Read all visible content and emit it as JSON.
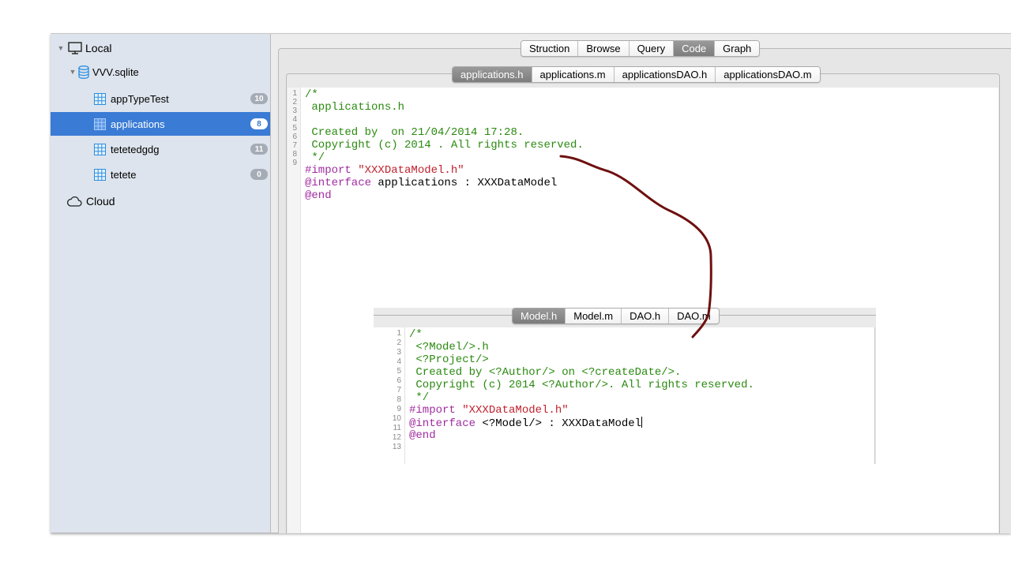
{
  "sidebar": {
    "local": {
      "label": "Local"
    },
    "database": {
      "label": "VVV.sqlite"
    },
    "tables": [
      {
        "label": "appTypeTest",
        "count": "10",
        "selected": false
      },
      {
        "label": "applications",
        "count": "8",
        "selected": true
      },
      {
        "label": "tetetedgdg",
        "count": "11",
        "selected": false
      },
      {
        "label": "tetete",
        "count": "0",
        "selected": false
      }
    ],
    "cloud": {
      "label": "Cloud"
    }
  },
  "top_tabs": [
    "Struction",
    "Browse",
    "Query",
    "Code",
    "Graph"
  ],
  "top_tabs_active": "Code",
  "file_tabs": [
    "applications.h",
    "applications.m",
    "applicationsDAO.h",
    "applicationsDAO.m"
  ],
  "file_tabs_active": "applications.h",
  "editor": {
    "line_numbers": [
      "1",
      "2",
      "3",
      "4",
      "5",
      "6",
      "7",
      "8",
      "9"
    ],
    "lines": [
      {
        "text": "/*",
        "kind": "comment"
      },
      {
        "text": " applications.h",
        "kind": "comment"
      },
      {
        "text": "",
        "kind": "comment"
      },
      {
        "text": " Created by  on 21/04/2014 17:28.",
        "kind": "comment"
      },
      {
        "text": " Copyright (c) 2014 . All rights reserved.",
        "kind": "comment"
      },
      {
        "text": " */",
        "kind": "comment"
      },
      {
        "text": "#import \"XXXDataModel.h\"",
        "kind": "import"
      },
      {
        "text": "@interface applications : XXXDataModel",
        "kind": "interface"
      },
      {
        "text": "@end",
        "kind": "directive"
      }
    ]
  },
  "template_tabs": [
    "Model.h",
    "Model.m",
    "DAO.h",
    "DAO.m"
  ],
  "template_tabs_active": "Model.h",
  "template_editor": {
    "line_numbers": [
      "1",
      "2",
      "3",
      "4",
      "5",
      "6",
      "7",
      "8",
      "9",
      "10",
      "11",
      "12",
      "13"
    ],
    "lines": [
      {
        "text": "/*",
        "kind": "comment"
      },
      {
        "text": " <?Model/>.h",
        "kind": "comment"
      },
      {
        "text": " <?Project/>",
        "kind": "comment"
      },
      {
        "text": " Created by <?Author/> on <?createDate/>.",
        "kind": "comment"
      },
      {
        "text": " Copyright (c) 2014 <?Author/>. All rights reserved.",
        "kind": "comment"
      },
      {
        "text": " */",
        "kind": "comment"
      },
      {
        "text": "#import \"XXXDataModel.h\"",
        "kind": "import"
      },
      {
        "text": "@interface <?Model/> : XXXDataModel",
        "kind": "interface"
      },
      {
        "text": "@end",
        "kind": "directive"
      }
    ]
  },
  "colors": {
    "selection": "#3a7bd5",
    "comment": "#2a8a10",
    "directive": "#a02ca0",
    "string": "#c0202c",
    "annotation_arrow": "#6e1010"
  },
  "icons": {
    "local": "monitor-icon",
    "database": "database-icon",
    "table": "table-grid-icon",
    "cloud": "cloud-icon"
  }
}
